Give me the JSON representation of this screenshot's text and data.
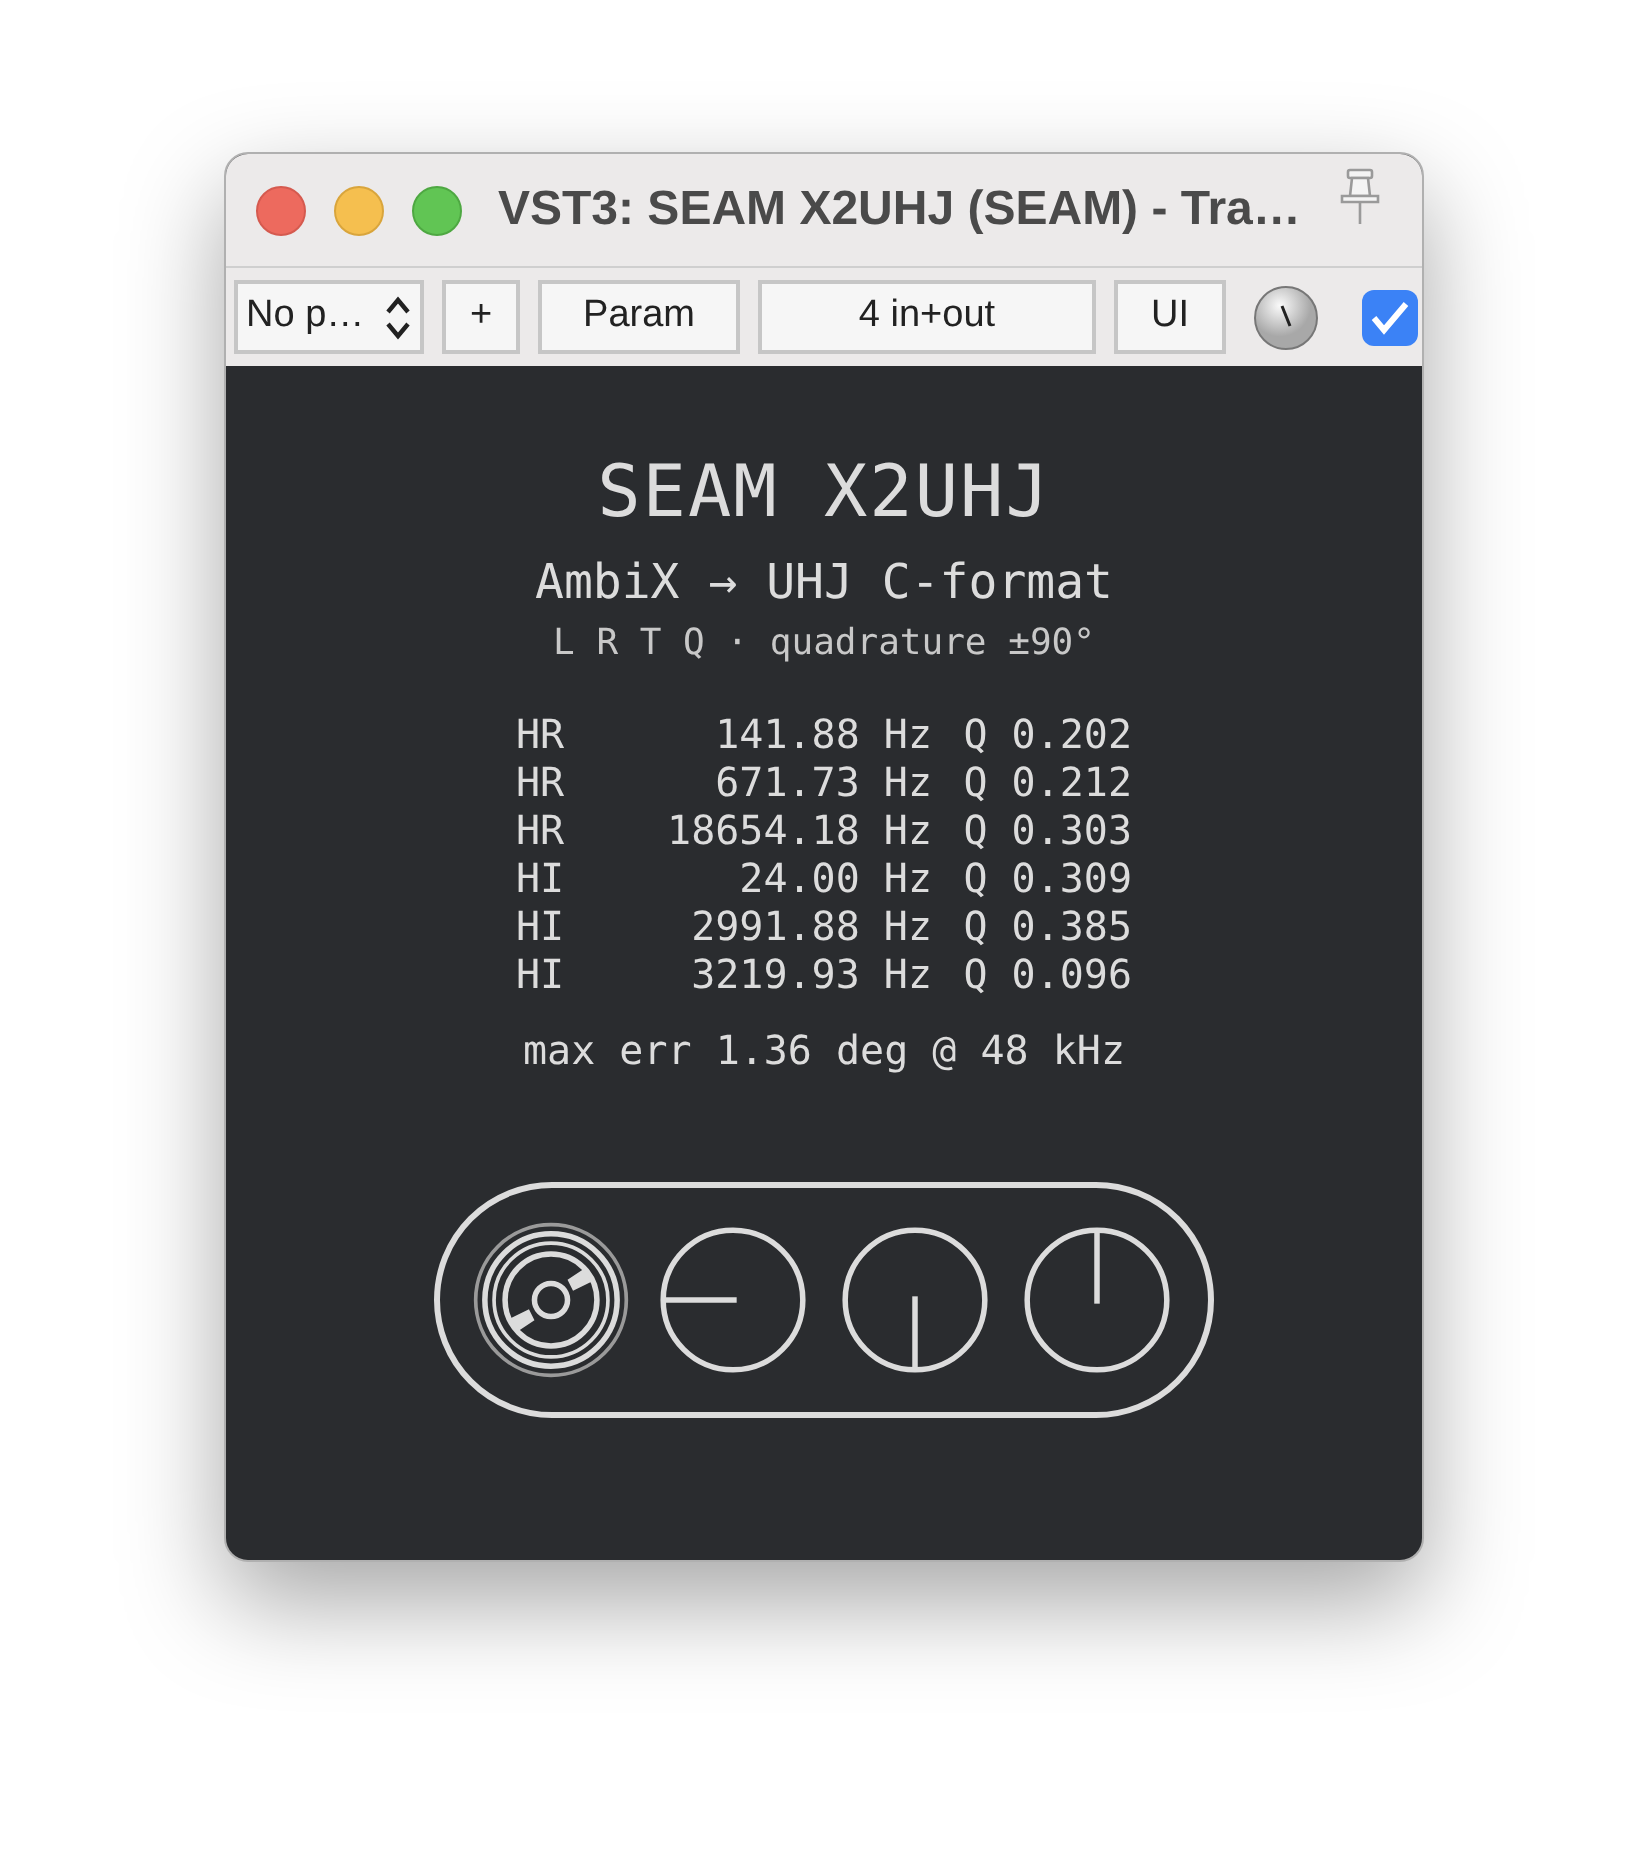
{
  "window": {
    "title": "VST3: SEAM X2UHJ (SEAM) - Tra…"
  },
  "toolbar": {
    "preset": "No p…",
    "buttons": [
      "+",
      "Param",
      "4 in+out",
      "UI"
    ],
    "bypass_enabled": true
  },
  "plugin": {
    "title": "SEAM X2UHJ",
    "subtitle": "AmbiX → UHJ C-format",
    "channels": "L R T Q · quadrature ±90°",
    "filters": [
      {
        "type": "HR",
        "freq": "141.88 Hz",
        "q": "Q 0.202"
      },
      {
        "type": "HR",
        "freq": "671.73 Hz",
        "q": "Q 0.212"
      },
      {
        "type": "HR",
        "freq": "18654.18 Hz",
        "q": "Q 0.303"
      },
      {
        "type": "HI",
        "freq": "24.00 Hz",
        "q": "Q 0.309"
      },
      {
        "type": "HI",
        "freq": "2991.88 Hz",
        "q": "Q 0.385"
      },
      {
        "type": "HI",
        "freq": "3219.93 Hz",
        "q": "Q 0.096"
      }
    ],
    "error": "max err 1.36 deg @ 48 kHz",
    "modes": [
      {
        "kind": "disc",
        "selected": true
      },
      {
        "kind": "left",
        "selected": false
      },
      {
        "kind": "down",
        "selected": false
      },
      {
        "kind": "up",
        "selected": false
      }
    ]
  }
}
